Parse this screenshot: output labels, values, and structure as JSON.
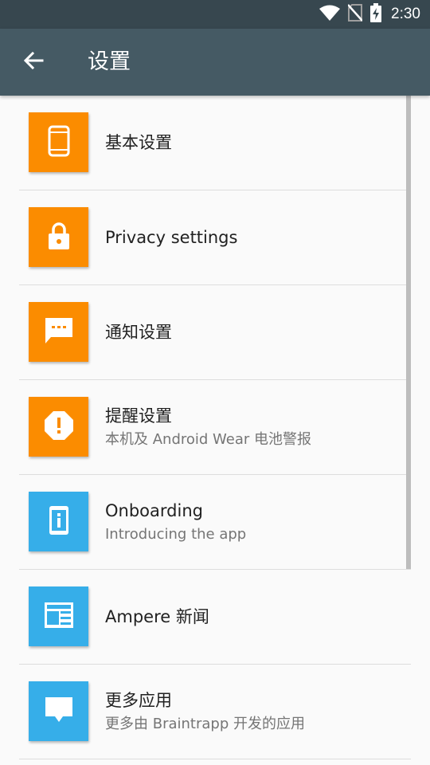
{
  "status_bar": {
    "time": "2:30",
    "icons": [
      "wifi-icon",
      "no-sim-icon",
      "battery-charging-icon"
    ]
  },
  "app_bar": {
    "title": "设置",
    "back_icon": "arrow-back-icon"
  },
  "colors": {
    "status_bar": "#37474f",
    "app_bar": "#455a64",
    "tile_orange": "#fb8c00",
    "tile_blue": "#36aee9"
  },
  "items": [
    {
      "title": "基本设置",
      "subtitle": "",
      "icon": "phone-icon",
      "color": "orange"
    },
    {
      "title": "Privacy settings",
      "subtitle": "",
      "icon": "lock-icon",
      "color": "orange"
    },
    {
      "title": "通知设置",
      "subtitle": "",
      "icon": "chat-bubble-icon",
      "color": "orange"
    },
    {
      "title": "提醒设置",
      "subtitle": "本机及 Android Wear 电池警报",
      "icon": "alert-octagon-icon",
      "color": "orange"
    },
    {
      "title": "Onboarding",
      "subtitle": "Introducing the app",
      "icon": "info-phone-icon",
      "color": "blue"
    },
    {
      "title": "Ampere 新闻",
      "subtitle": "",
      "icon": "newspaper-icon",
      "color": "blue"
    },
    {
      "title": "更多应用",
      "subtitle": "更多由 Braintrapp 开发的应用",
      "icon": "message-icon",
      "color": "blue"
    }
  ]
}
